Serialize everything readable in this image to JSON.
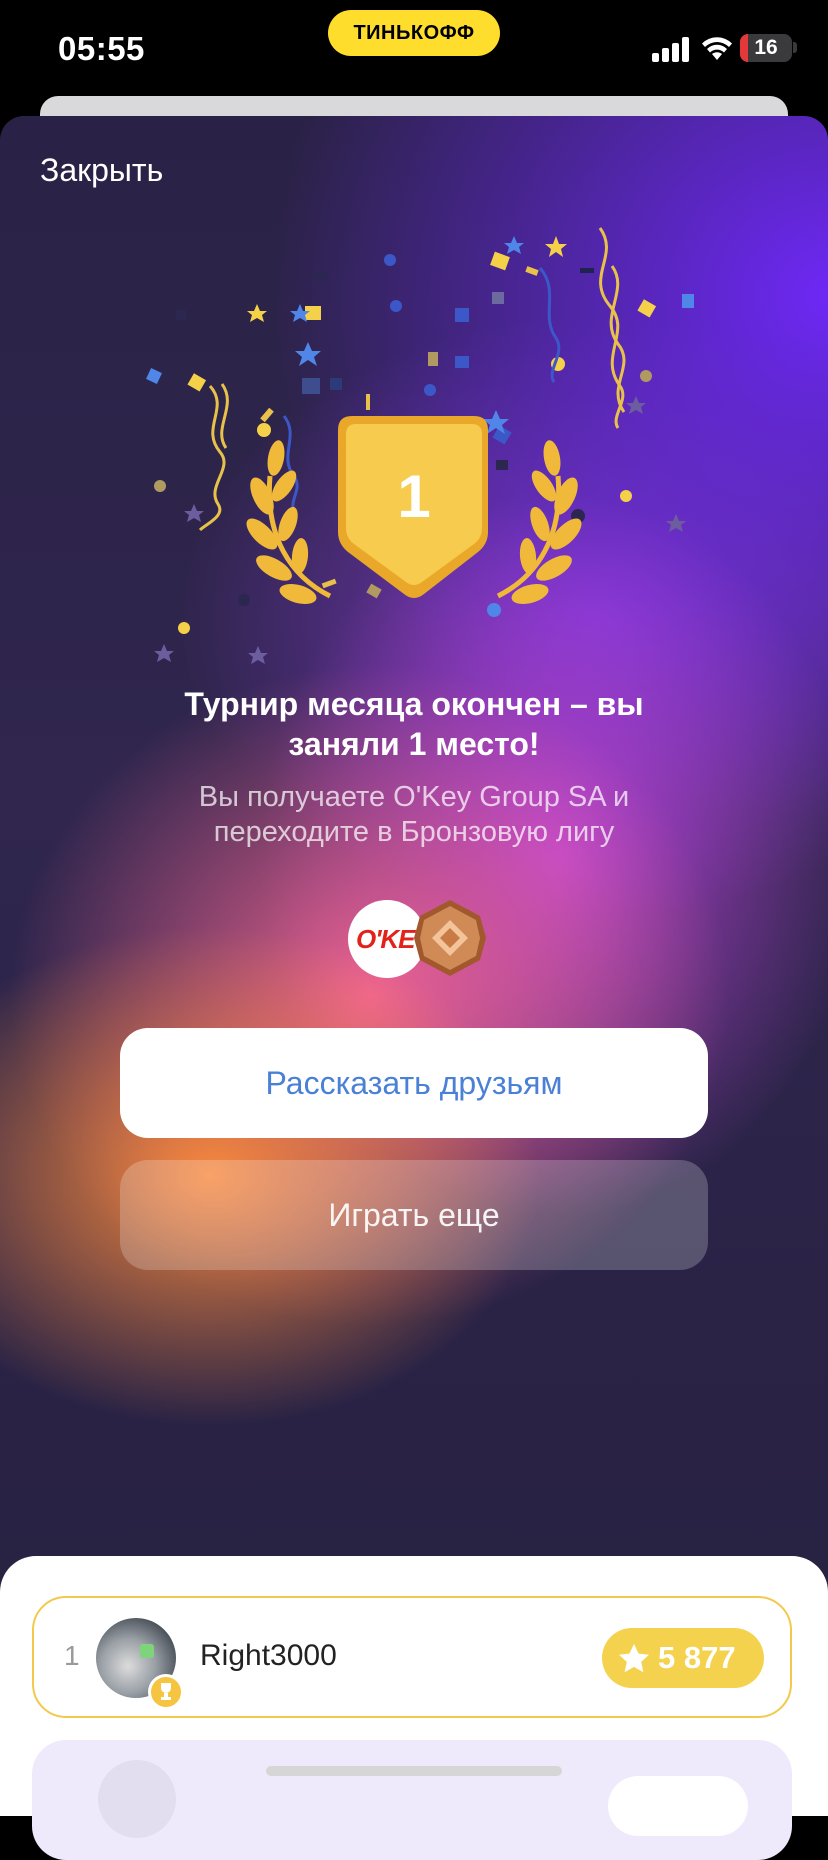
{
  "status_bar": {
    "time": "05:55",
    "brand": "ТИНЬКОФФ",
    "battery_level": "16",
    "icons": [
      "cellular-signal-icon",
      "wifi-icon",
      "battery-icon"
    ]
  },
  "modal": {
    "close_label": "Закрыть",
    "place_number": "1",
    "headline": "Турнир месяца окончен – вы заняли 1 место!",
    "subline": "Вы получаете O'Key Group SA и переходите в Бронзовую лигу",
    "reward_logo_text": "O'KEY",
    "share_button": "Рассказать друзьям",
    "play_again_button": "Играть еще"
  },
  "leaderboard": {
    "rows": [
      {
        "rank": "1",
        "username": "Right3000",
        "score": "5 877"
      }
    ]
  },
  "colors": {
    "brand_yellow": "#FFDD2D",
    "link_blue": "#4A80D6",
    "score_yellow": "#F5D24E",
    "medal_gold": "#F2BE3A"
  }
}
